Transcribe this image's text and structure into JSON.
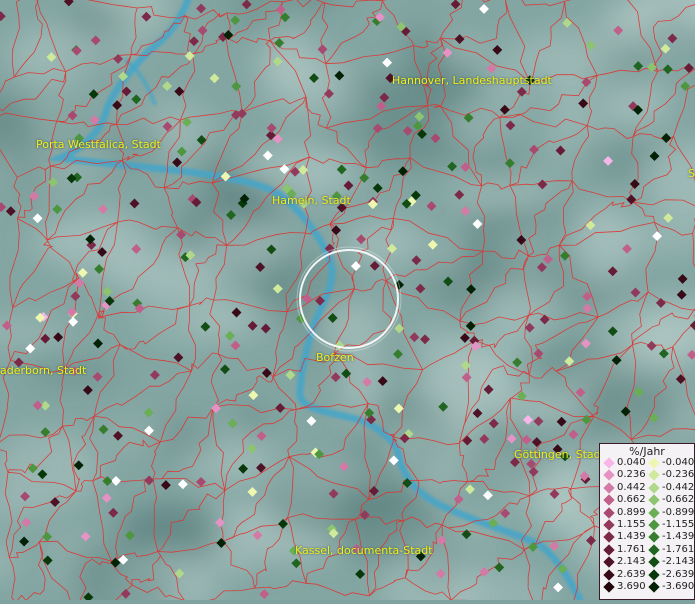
{
  "cities": [
    {
      "name": "Hannover, Landeshauptstadt"
    },
    {
      "name": "Porta Westfalica, Stadt"
    },
    {
      "name": "Hameln, Stadt"
    },
    {
      "name": "Bofzen"
    },
    {
      "name": "aderborn, Stadt"
    },
    {
      "name": "Göttingen, Stadt"
    },
    {
      "name": "Kassel, documenta-Stadt"
    },
    {
      "name": "S"
    }
  ],
  "legend": {
    "title": "%/Jahr",
    "positive": [
      {
        "value": "0.040",
        "color": "#f7b6e8"
      },
      {
        "value": "0.236",
        "color": "#e592c4"
      },
      {
        "value": "0.442",
        "color": "#d47aa6"
      },
      {
        "value": "0.662",
        "color": "#c0608a"
      },
      {
        "value": "0.899",
        "color": "#a84a70"
      },
      {
        "value": "1.155",
        "color": "#923a5c"
      },
      {
        "value": "1.439",
        "color": "#7c2a48"
      },
      {
        "value": "1.761",
        "color": "#661c36"
      },
      {
        "value": "2.143",
        "color": "#4e1226"
      },
      {
        "value": "2.639",
        "color": "#380a18"
      },
      {
        "value": "3.690",
        "color": "#22040c"
      }
    ],
    "negative": [
      {
        "value": "-0.040",
        "color": "#eef7b0"
      },
      {
        "value": "-0.236",
        "color": "#d0ea9c"
      },
      {
        "value": "-0.442",
        "color": "#b0d88a"
      },
      {
        "value": "-0.662",
        "color": "#8cc470"
      },
      {
        "value": "-0.899",
        "color": "#6aae56"
      },
      {
        "value": "-1.155",
        "color": "#4e9640"
      },
      {
        "value": "-1.439",
        "color": "#367e2e"
      },
      {
        "value": "-1.761",
        "color": "#206620"
      },
      {
        "value": "-2.143",
        "color": "#124e14"
      },
      {
        "value": "-2.639",
        "color": "#08380a"
      },
      {
        "value": "-3.690",
        "color": "#032205"
      }
    ]
  },
  "colors": {
    "terrain": "#7fa2a0",
    "river": "#4aa6cc",
    "boundary": "#e0302c",
    "label": "#f2ee1a"
  }
}
